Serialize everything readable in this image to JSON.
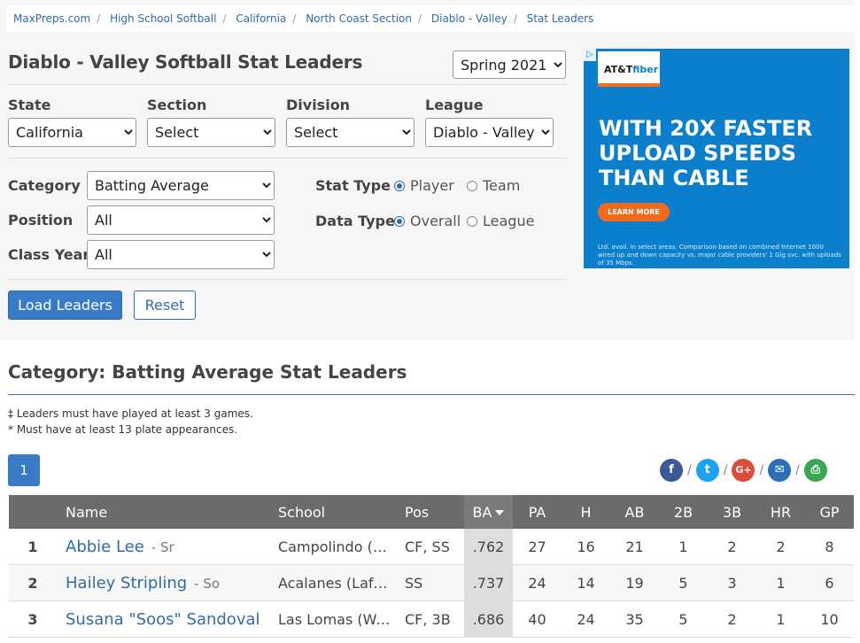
{
  "breadcrumb": [
    "MaxPreps.com",
    "High School Softball",
    "California",
    "North Coast Section",
    "Diablo - Valley",
    "Stat Leaders"
  ],
  "page_title": "Diablo - Valley Softball Stat Leaders",
  "season": {
    "selected": "Spring 2021"
  },
  "filters": {
    "state": {
      "label": "State",
      "value": "California"
    },
    "section": {
      "label": "Section",
      "value": "Select"
    },
    "division": {
      "label": "Division",
      "value": "Select"
    },
    "league": {
      "label": "League",
      "value": "Diablo - Valley"
    },
    "category": {
      "label": "Category",
      "value": "Batting Average"
    },
    "position": {
      "label": "Position",
      "value": "All"
    },
    "class_year": {
      "label": "Class Year",
      "value": "All"
    },
    "stat_type": {
      "label": "Stat Type",
      "options": [
        "Player",
        "Team"
      ],
      "selected": "Player"
    },
    "data_type": {
      "label": "Data Type",
      "options": [
        "Overall",
        "League"
      ],
      "selected": "Overall"
    }
  },
  "buttons": {
    "load": "Load Leaders",
    "reset": "Reset"
  },
  "ad": {
    "brand_prefix": "AT&T",
    "brand_suffix": "fiber",
    "headline": "WITH 20X FASTER UPLOAD SPEEDS THAN CABLE",
    "cta": "LEARN MORE",
    "fine_print": "Ltd. avail. in select areas. Comparison based on combined Internet 1000 wired up and down capacity vs. major cable providers' 1 Gig svc. with uploads of 35 Mbps.",
    "corner": "▷",
    "colors": {
      "background": "#0b7fcc",
      "accent": "#f26b1d"
    }
  },
  "category_title": "Category: Batting Average Stat Leaders",
  "notes": [
    "‡ Leaders must have played at least 3 games.",
    "* Must have at least 13 plate appearances."
  ],
  "pager": {
    "current": "1"
  },
  "social": [
    {
      "icon": "facebook-icon",
      "glyph": "f",
      "color": "#3b5998"
    },
    {
      "icon": "twitter-icon",
      "glyph": "t",
      "color": "#1da1f2"
    },
    {
      "icon": "google-plus-icon",
      "glyph": "G+",
      "color": "#dd4b39"
    },
    {
      "icon": "email-icon",
      "glyph": "✉",
      "color": "#2d6fb4"
    },
    {
      "icon": "print-icon",
      "glyph": "⎙",
      "color": "#3aa757"
    }
  ],
  "social_sep": "/",
  "table": {
    "columns": [
      "",
      "Name",
      "School",
      "Pos",
      "BA",
      "PA",
      "H",
      "AB",
      "2B",
      "3B",
      "HR",
      "GP"
    ],
    "sorted_column": "BA",
    "rows": [
      {
        "rank": "1",
        "name": "Abbie Lee",
        "year": "- Sr",
        "school": "Campolindo (Moraga)",
        "pos": "CF, SS",
        "ba": ".762",
        "pa": "27",
        "h": "16",
        "ab": "21",
        "2b": "1",
        "3b": "2",
        "hr": "2",
        "gp": "8"
      },
      {
        "rank": "2",
        "name": "Hailey Stripling",
        "year": "- So",
        "school": "Acalanes (Lafayette)",
        "pos": "SS",
        "ba": ".737",
        "pa": "24",
        "h": "14",
        "ab": "19",
        "2b": "5",
        "3b": "3",
        "hr": "1",
        "gp": "6"
      },
      {
        "rank": "3",
        "name": "Susana \"Soos\" Sandoval",
        "year": "",
        "school": "Las Lomas (Walnut Creek)",
        "pos": "CF, 3B",
        "ba": ".686",
        "pa": "40",
        "h": "24",
        "ab": "35",
        "2b": "5",
        "3b": "2",
        "hr": "1",
        "gp": "10"
      }
    ]
  }
}
